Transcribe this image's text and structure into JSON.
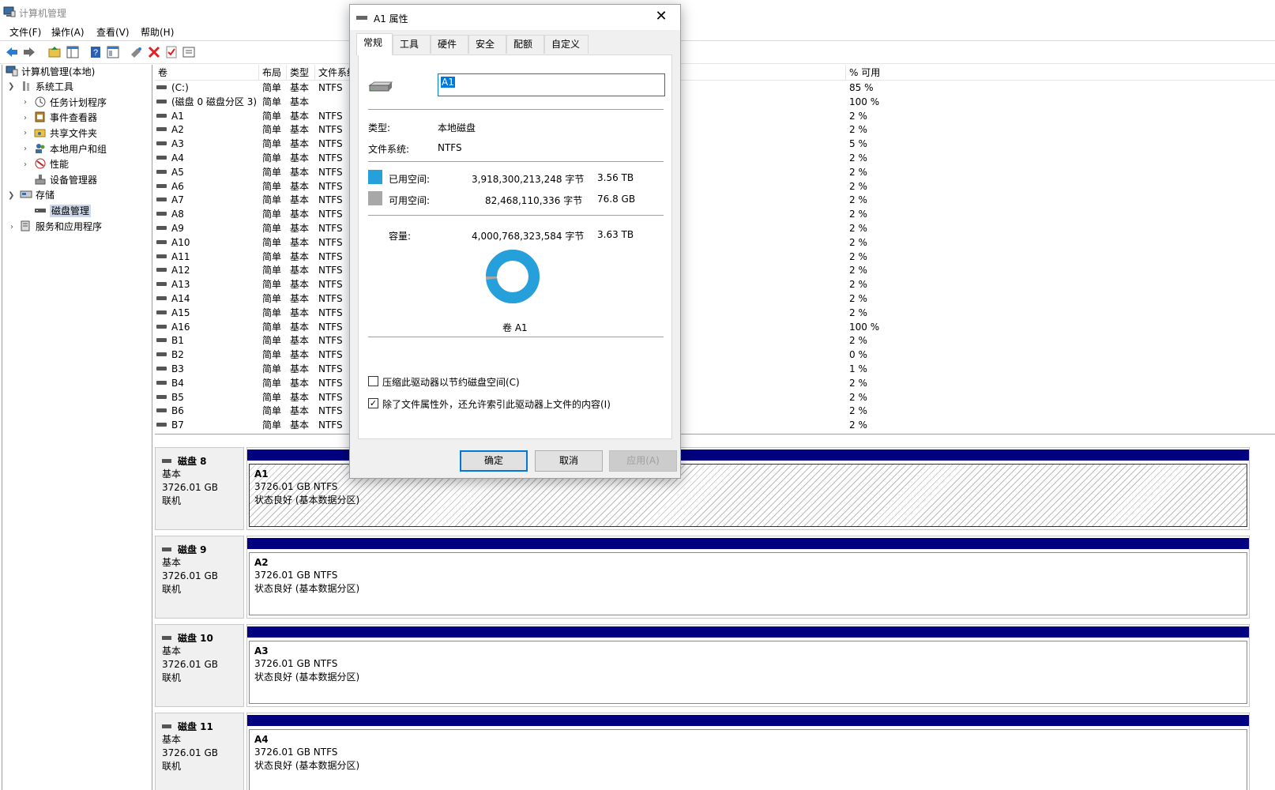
{
  "window": {
    "title": "计算机管理"
  },
  "menu": [
    "文件(F)",
    "操作(A)",
    "查看(V)",
    "帮助(H)"
  ],
  "tree": [
    {
      "label": "计算机管理(本地)",
      "level": 0,
      "icon": "computer-management-icon"
    },
    {
      "label": "系统工具",
      "level": 1,
      "expanded": true,
      "icon": "system-tools-icon"
    },
    {
      "label": "任务计划程序",
      "level": 2,
      "icon": "task-scheduler-icon"
    },
    {
      "label": "事件查看器",
      "level": 2,
      "icon": "event-viewer-icon"
    },
    {
      "label": "共享文件夹",
      "level": 2,
      "icon": "shared-folders-icon"
    },
    {
      "label": "本地用户和组",
      "level": 2,
      "icon": "local-users-icon"
    },
    {
      "label": "性能",
      "level": 2,
      "icon": "performance-icon"
    },
    {
      "label": "设备管理器",
      "level": 2,
      "icon": "device-manager-icon"
    },
    {
      "label": "存储",
      "level": 1,
      "expanded": true,
      "icon": "storage-icon"
    },
    {
      "label": "磁盘管理",
      "level": 2,
      "selected": true,
      "icon": "disk-management-icon"
    },
    {
      "label": "服务和应用程序",
      "level": 1,
      "expanded": false,
      "icon": "services-icon"
    }
  ],
  "list": {
    "columns": [
      "卷",
      "布局",
      "类型",
      "文件系统",
      "% 可用"
    ],
    "rows": [
      {
        "vol": "(C:)",
        "layout": "简单",
        "type": "基本",
        "fs": "NTFS",
        "free": "85 %"
      },
      {
        "vol": "(磁盘 0 磁盘分区 3)",
        "layout": "简单",
        "type": "基本",
        "fs": "",
        "free": "100 %"
      },
      {
        "vol": "A1",
        "layout": "简单",
        "type": "基本",
        "fs": "NTFS",
        "free": "2 %"
      },
      {
        "vol": "A2",
        "layout": "简单",
        "type": "基本",
        "fs": "NTFS",
        "free": "2 %"
      },
      {
        "vol": "A3",
        "layout": "简单",
        "type": "基本",
        "fs": "NTFS",
        "free": "5 %"
      },
      {
        "vol": "A4",
        "layout": "简单",
        "type": "基本",
        "fs": "NTFS",
        "free": "2 %"
      },
      {
        "vol": "A5",
        "layout": "简单",
        "type": "基本",
        "fs": "NTFS",
        "free": "2 %"
      },
      {
        "vol": "A6",
        "layout": "简单",
        "type": "基本",
        "fs": "NTFS",
        "free": "2 %"
      },
      {
        "vol": "A7",
        "layout": "简单",
        "type": "基本",
        "fs": "NTFS",
        "free": "2 %"
      },
      {
        "vol": "A8",
        "layout": "简单",
        "type": "基本",
        "fs": "NTFS",
        "free": "2 %"
      },
      {
        "vol": "A9",
        "layout": "简单",
        "type": "基本",
        "fs": "NTFS",
        "free": "2 %"
      },
      {
        "vol": "A10",
        "layout": "简单",
        "type": "基本",
        "fs": "NTFS",
        "free": "2 %"
      },
      {
        "vol": "A11",
        "layout": "简单",
        "type": "基本",
        "fs": "NTFS",
        "free": "2 %"
      },
      {
        "vol": "A12",
        "layout": "简单",
        "type": "基本",
        "fs": "NTFS",
        "free": "2 %"
      },
      {
        "vol": "A13",
        "layout": "简单",
        "type": "基本",
        "fs": "NTFS",
        "free": "2 %"
      },
      {
        "vol": "A14",
        "layout": "简单",
        "type": "基本",
        "fs": "NTFS",
        "free": "2 %"
      },
      {
        "vol": "A15",
        "layout": "简单",
        "type": "基本",
        "fs": "NTFS",
        "free": "2 %"
      },
      {
        "vol": "A16",
        "layout": "简单",
        "type": "基本",
        "fs": "NTFS",
        "free": "100 %"
      },
      {
        "vol": "B1",
        "layout": "简单",
        "type": "基本",
        "fs": "NTFS",
        "free": "2 %"
      },
      {
        "vol": "B2",
        "layout": "简单",
        "type": "基本",
        "fs": "NTFS",
        "free": "0 %"
      },
      {
        "vol": "B3",
        "layout": "简单",
        "type": "基本",
        "fs": "NTFS",
        "free": "1 %"
      },
      {
        "vol": "B4",
        "layout": "简单",
        "type": "基本",
        "fs": "NTFS",
        "free": "2 %"
      },
      {
        "vol": "B5",
        "layout": "简单",
        "type": "基本",
        "fs": "NTFS",
        "free": "2 %"
      },
      {
        "vol": "B6",
        "layout": "简单",
        "type": "基本",
        "fs": "NTFS",
        "free": "2 %"
      },
      {
        "vol": "B7",
        "layout": "简单",
        "type": "基本",
        "fs": "NTFS",
        "free": "2 %"
      }
    ]
  },
  "disks": [
    {
      "name": "磁盘 8",
      "kind": "基本",
      "size": "3726.01 GB",
      "status": "联机",
      "part_name": "A1",
      "part_size": "3726.01 GB NTFS",
      "part_status": "状态良好 (基本数据分区)",
      "selected": true
    },
    {
      "name": "磁盘 9",
      "kind": "基本",
      "size": "3726.01 GB",
      "status": "联机",
      "part_name": "A2",
      "part_size": "3726.01 GB NTFS",
      "part_status": "状态良好 (基本数据分区)"
    },
    {
      "name": "磁盘 10",
      "kind": "基本",
      "size": "3726.01 GB",
      "status": "联机",
      "part_name": "A3",
      "part_size": "3726.01 GB NTFS",
      "part_status": "状态良好 (基本数据分区)"
    },
    {
      "name": "磁盘 11",
      "kind": "基本",
      "size": "3726.01 GB",
      "status": "联机",
      "part_name": "A4",
      "part_size": "3726.01 GB NTFS",
      "part_status": "状态良好 (基本数据分区)"
    }
  ],
  "dialog": {
    "title": "A1 属性",
    "tabs": [
      "常规",
      "工具",
      "硬件",
      "安全",
      "配额",
      "自定义"
    ],
    "active_tab": "常规",
    "name_value": "A1",
    "type_label": "类型:",
    "type_value": "本地磁盘",
    "fs_label": "文件系统:",
    "fs_value": "NTFS",
    "used_label": "已用空间:",
    "used_bytes": "3,918,300,213,248 字节",
    "used_human": "3.56 TB",
    "free_label": "可用空间:",
    "free_bytes": "82,468,110,336 字节",
    "free_human": "76.8 GB",
    "cap_label": "容量:",
    "cap_bytes": "4,000,768,323,584 字节",
    "cap_human": "3.63 TB",
    "used_fraction": 0.979,
    "drive_label": "卷 A1",
    "compress_label": "压缩此驱动器以节约磁盘空间(C)",
    "compress_checked": false,
    "index_label": "除了文件属性外，还允许索引此驱动器上文件的内容(I)",
    "index_checked": true,
    "ok": "确定",
    "cancel": "取消",
    "apply": "应用(A)",
    "colors": {
      "used": "#26a0da",
      "free": "#a8a8a8"
    }
  }
}
